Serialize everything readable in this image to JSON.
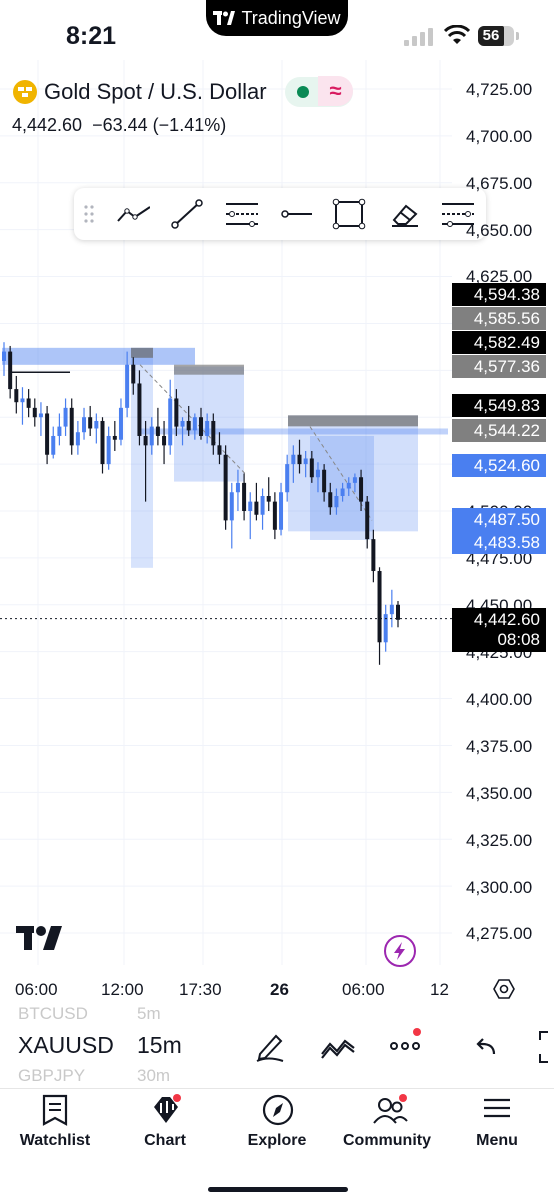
{
  "status_bar": {
    "time": "8:21",
    "island_brand": "TradingView",
    "battery": "56"
  },
  "header": {
    "symbol_title": "Gold Spot / U.S. Dollar",
    "last_price": "4,442.60",
    "change": "−63.44",
    "change_pct": "(−1.41%)",
    "delay_glyph": "≈"
  },
  "toolbar": {
    "tools": [
      "trend-angle",
      "trend-line",
      "fib-retracement",
      "horizontal-ray",
      "rectangle",
      "eraser",
      "more-tools"
    ]
  },
  "price_axis": {
    "ticks": [
      "4,725.00",
      "4,700.00",
      "4,675.00",
      "4,650.00",
      "4,625.00",
      "4,500.00",
      "4,475.00",
      "4,450.00",
      "4,425.00",
      "4,400.00",
      "4,375.00",
      "4,350.00",
      "4,325.00",
      "4,300.00",
      "4,275.00"
    ],
    "labels": [
      {
        "text": "4,594.38",
        "color": "#000000"
      },
      {
        "text": "4,585.56",
        "color": "#808080"
      },
      {
        "text": "4,582.49",
        "color": "#000000"
      },
      {
        "text": "4,577.36",
        "color": "#808080"
      },
      {
        "text": "4,549.83",
        "color": "#000000"
      },
      {
        "text": "4,544.22",
        "color": "#808080"
      },
      {
        "text": "4,524.60",
        "color": "#4a7ff0"
      },
      {
        "text": "4,487.50",
        "color": "#4a7ff0"
      },
      {
        "text": "4,483.58",
        "color": "#4a7ff0"
      }
    ],
    "current": {
      "price": "4,442.60",
      "countdown": "08:08"
    }
  },
  "time_axis": {
    "ticks": [
      "06:00",
      "12:00",
      "17:30",
      "26",
      "06:00",
      "12"
    ]
  },
  "chart_data": {
    "type": "candlestick",
    "symbol": "XAUUSD",
    "interval": "15m",
    "ylim": [
      4262,
      4740
    ],
    "candles": [
      {
        "o": 4580,
        "h": 4590,
        "l": 4572,
        "c": 4585
      },
      {
        "o": 4585,
        "h": 4588,
        "l": 4560,
        "c": 4565
      },
      {
        "o": 4565,
        "h": 4572,
        "l": 4552,
        "c": 4558
      },
      {
        "o": 4558,
        "h": 4566,
        "l": 4546,
        "c": 4560
      },
      {
        "o": 4560,
        "h": 4565,
        "l": 4550,
        "c": 4555
      },
      {
        "o": 4555,
        "h": 4560,
        "l": 4545,
        "c": 4550
      },
      {
        "o": 4550,
        "h": 4558,
        "l": 4540,
        "c": 4552
      },
      {
        "o": 4552,
        "h": 4556,
        "l": 4525,
        "c": 4530
      },
      {
        "o": 4530,
        "h": 4545,
        "l": 4528,
        "c": 4540
      },
      {
        "o": 4540,
        "h": 4552,
        "l": 4535,
        "c": 4545
      },
      {
        "o": 4545,
        "h": 4560,
        "l": 4540,
        "c": 4555
      },
      {
        "o": 4555,
        "h": 4560,
        "l": 4530,
        "c": 4535
      },
      {
        "o": 4535,
        "h": 4548,
        "l": 4530,
        "c": 4542
      },
      {
        "o": 4542,
        "h": 4555,
        "l": 4538,
        "c": 4550
      },
      {
        "o": 4550,
        "h": 4556,
        "l": 4540,
        "c": 4544
      },
      {
        "o": 4544,
        "h": 4552,
        "l": 4536,
        "c": 4548
      },
      {
        "o": 4548,
        "h": 4550,
        "l": 4520,
        "c": 4525
      },
      {
        "o": 4525,
        "h": 4545,
        "l": 4522,
        "c": 4540
      },
      {
        "o": 4540,
        "h": 4548,
        "l": 4532,
        "c": 4538
      },
      {
        "o": 4538,
        "h": 4560,
        "l": 4535,
        "c": 4555
      },
      {
        "o": 4555,
        "h": 4585,
        "l": 4550,
        "c": 4578
      },
      {
        "o": 4578,
        "h": 4582,
        "l": 4562,
        "c": 4568
      },
      {
        "o": 4568,
        "h": 4575,
        "l": 4535,
        "c": 4540
      },
      {
        "o": 4540,
        "h": 4548,
        "l": 4505,
        "c": 4535
      },
      {
        "o": 4535,
        "h": 4550,
        "l": 4530,
        "c": 4545
      },
      {
        "o": 4545,
        "h": 4555,
        "l": 4535,
        "c": 4540
      },
      {
        "o": 4540,
        "h": 4548,
        "l": 4525,
        "c": 4535
      },
      {
        "o": 4535,
        "h": 4570,
        "l": 4530,
        "c": 4560
      },
      {
        "o": 4560,
        "h": 4565,
        "l": 4540,
        "c": 4545
      },
      {
        "o": 4545,
        "h": 4550,
        "l": 4535,
        "c": 4548
      },
      {
        "o": 4548,
        "h": 4556,
        "l": 4540,
        "c": 4543
      },
      {
        "o": 4543,
        "h": 4552,
        "l": 4538,
        "c": 4550
      },
      {
        "o": 4550,
        "h": 4555,
        "l": 4538,
        "c": 4540
      },
      {
        "o": 4540,
        "h": 4552,
        "l": 4536,
        "c": 4548
      },
      {
        "o": 4548,
        "h": 4552,
        "l": 4530,
        "c": 4535
      },
      {
        "o": 4535,
        "h": 4542,
        "l": 4525,
        "c": 4530
      },
      {
        "o": 4530,
        "h": 4535,
        "l": 4490,
        "c": 4495
      },
      {
        "o": 4495,
        "h": 4515,
        "l": 4480,
        "c": 4510
      },
      {
        "o": 4510,
        "h": 4522,
        "l": 4500,
        "c": 4515
      },
      {
        "o": 4515,
        "h": 4520,
        "l": 4495,
        "c": 4500
      },
      {
        "o": 4500,
        "h": 4510,
        "l": 4485,
        "c": 4505
      },
      {
        "o": 4505,
        "h": 4515,
        "l": 4495,
        "c": 4498
      },
      {
        "o": 4498,
        "h": 4512,
        "l": 4490,
        "c": 4508
      },
      {
        "o": 4508,
        "h": 4518,
        "l": 4500,
        "c": 4505
      },
      {
        "o": 4505,
        "h": 4510,
        "l": 4485,
        "c": 4490
      },
      {
        "o": 4490,
        "h": 4515,
        "l": 4487,
        "c": 4510
      },
      {
        "o": 4510,
        "h": 4530,
        "l": 4505,
        "c": 4525
      },
      {
        "o": 4525,
        "h": 4535,
        "l": 4515,
        "c": 4530
      },
      {
        "o": 4530,
        "h": 4538,
        "l": 4520,
        "c": 4525
      },
      {
        "o": 4525,
        "h": 4532,
        "l": 4518,
        "c": 4528
      },
      {
        "o": 4528,
        "h": 4532,
        "l": 4515,
        "c": 4518
      },
      {
        "o": 4518,
        "h": 4526,
        "l": 4510,
        "c": 4522
      },
      {
        "o": 4522,
        "h": 4525,
        "l": 4505,
        "c": 4510
      },
      {
        "o": 4510,
        "h": 4515,
        "l": 4498,
        "c": 4502
      },
      {
        "o": 4502,
        "h": 4512,
        "l": 4498,
        "c": 4508
      },
      {
        "o": 4508,
        "h": 4515,
        "l": 4505,
        "c": 4512
      },
      {
        "o": 4512,
        "h": 4518,
        "l": 4508,
        "c": 4515
      },
      {
        "o": 4515,
        "h": 4520,
        "l": 4510,
        "c": 4518
      },
      {
        "o": 4518,
        "h": 4522,
        "l": 4500,
        "c": 4505
      },
      {
        "o": 4505,
        "h": 4508,
        "l": 4480,
        "c": 4485
      },
      {
        "o": 4485,
        "h": 4490,
        "l": 4462,
        "c": 4468
      },
      {
        "o": 4468,
        "h": 4470,
        "l": 4418,
        "c": 4430
      },
      {
        "o": 4430,
        "h": 4450,
        "l": 4425,
        "c": 4445
      },
      {
        "o": 4445,
        "h": 4458,
        "l": 4438,
        "c": 4450
      },
      {
        "o": 4450,
        "h": 4452,
        "l": 4438,
        "c": 4442
      }
    ],
    "last_price": 4442.6
  },
  "bottom": {
    "ghost_above": {
      "symbol": "BTCUSD",
      "interval": "5m"
    },
    "symbol": "XAUUSD",
    "interval": "15m",
    "ghost_below": {
      "symbol": "GBPJPY",
      "interval": "30m"
    }
  },
  "nav": {
    "items": [
      {
        "label": "Watchlist"
      },
      {
        "label": "Chart"
      },
      {
        "label": "Explore"
      },
      {
        "label": "Community"
      },
      {
        "label": "Menu"
      }
    ]
  }
}
